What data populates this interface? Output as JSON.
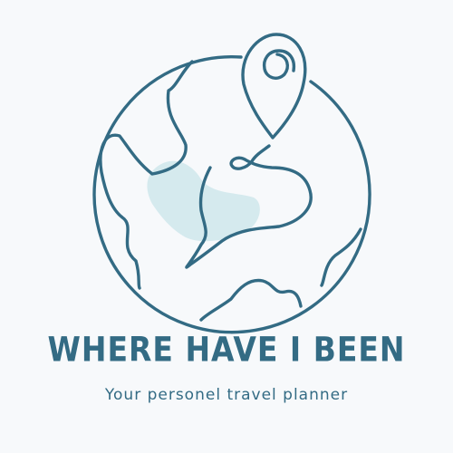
{
  "brand": {
    "title": "WHERE HAVE I BEEN",
    "tagline": "Your personel travel planner"
  },
  "colors": {
    "background": "#f7f9fb",
    "primary": "#336b84",
    "accent_blob": "#d5eaee"
  },
  "icons": {
    "logo": "globe-with-location-pin"
  }
}
